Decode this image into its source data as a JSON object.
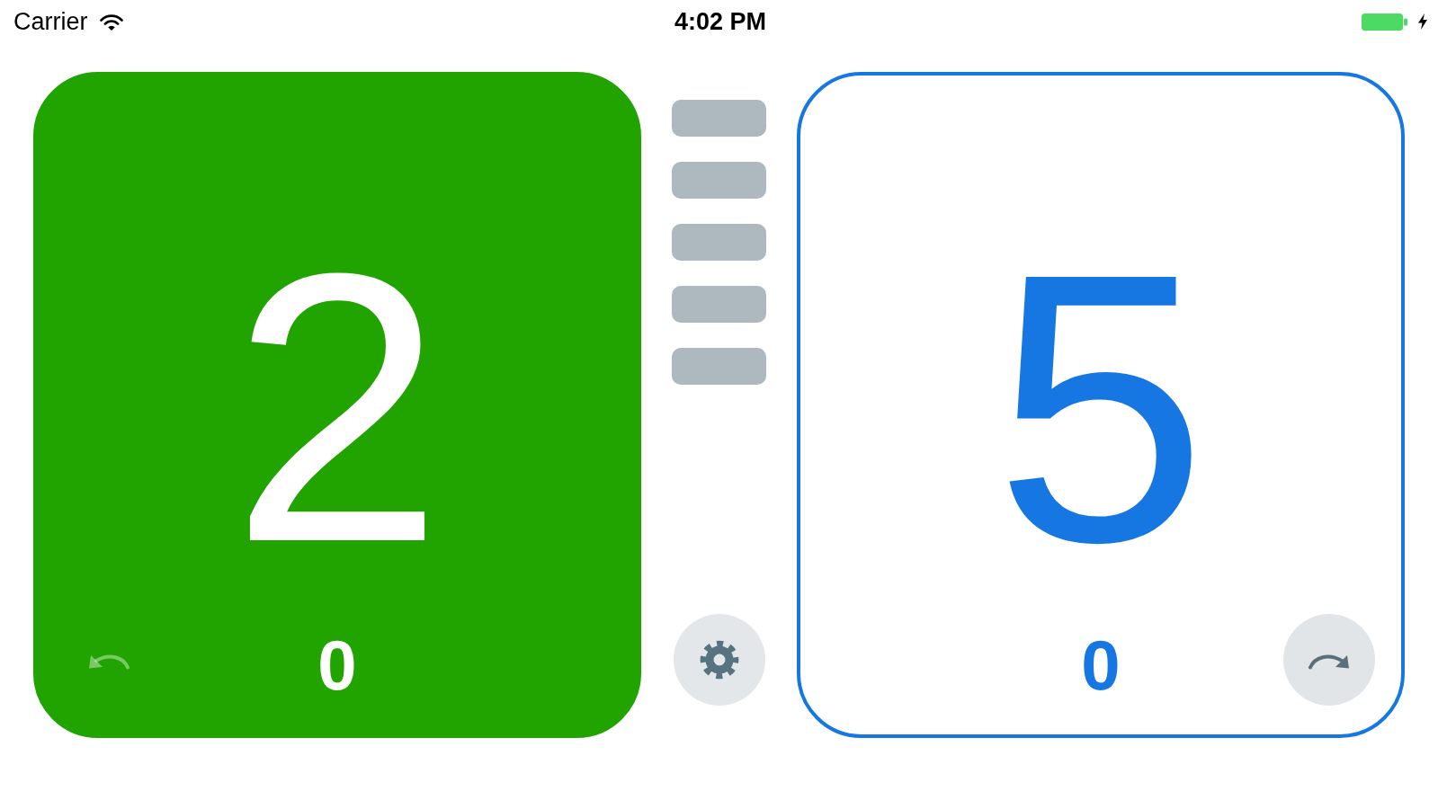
{
  "status_bar": {
    "carrier": "Carrier",
    "time": "4:02 PM",
    "charging": true
  },
  "players": [
    {
      "score": "2",
      "sub_score": "0",
      "color": "#21a300",
      "selected": true,
      "button": {
        "kind": "undo"
      }
    },
    {
      "score": "5",
      "sub_score": "0",
      "color": "#1677e2",
      "selected": false,
      "button": {
        "kind": "redo"
      }
    }
  ]
}
